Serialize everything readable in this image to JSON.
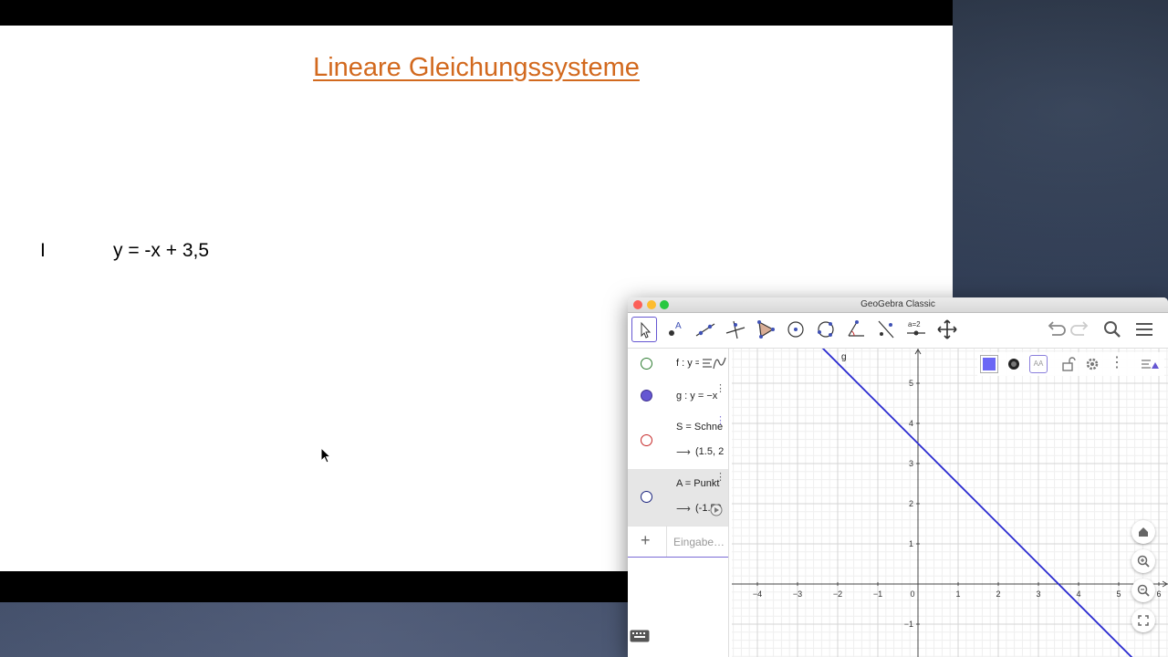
{
  "slide": {
    "title": "Lineare Gleichungssysteme",
    "equation_label": "I",
    "equation_text": "y = -x + 3,5"
  },
  "geogebra": {
    "window_title": "GeoGebra Classic",
    "toolbar": [
      "move-tool",
      "point-tool",
      "line-tool",
      "perpendicular-tool",
      "polygon-tool",
      "circle-tool",
      "conic-tool",
      "angle-tool",
      "reflect-tool",
      "slider-tool",
      "move-view-tool"
    ],
    "algebra": {
      "rows": [
        {
          "text": "f : y = ",
          "marker_color": "#2e7d32",
          "filled": false
        },
        {
          "text": "g : y = −x",
          "marker_color": "#6557d2",
          "filled": true
        },
        {
          "text": "S = Schne",
          "value": "(1.5, 2",
          "marker_color": "#c62828",
          "filled": false
        },
        {
          "text": "A = Punkt",
          "value": "(-1.59",
          "marker_color": "#1a237e",
          "filled": false
        }
      ],
      "input_placeholder": "Eingabe…",
      "plus": "+",
      "arrow": "⟶"
    },
    "graphics": {
      "line_label": "g",
      "line_color": "#2a2ad0",
      "x_ticks": [
        "−4",
        "−3",
        "−2",
        "−1",
        "0",
        "1",
        "2",
        "3",
        "4",
        "5",
        "6"
      ],
      "y_ticks": [
        "5",
        "4",
        "3",
        "2",
        "1",
        "−1"
      ],
      "style_color": "#6b67f5"
    }
  }
}
